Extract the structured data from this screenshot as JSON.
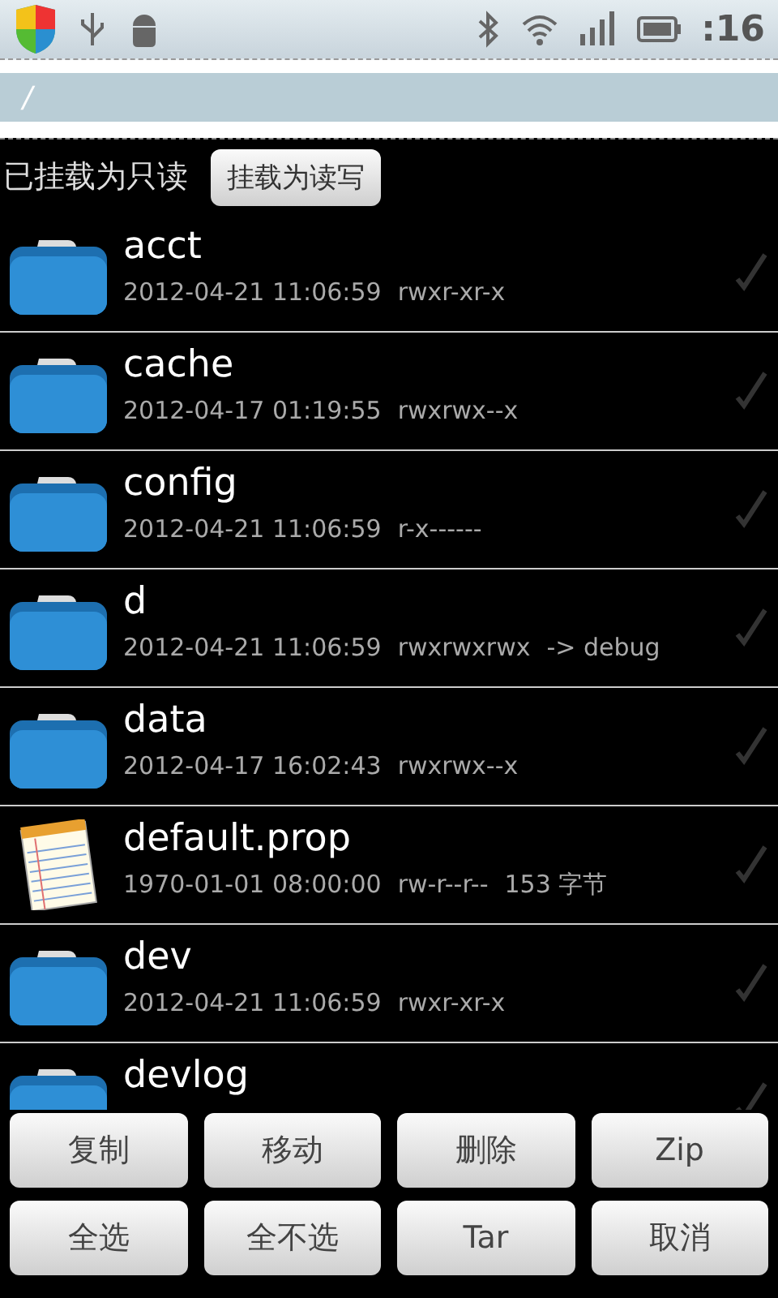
{
  "status_bar": {
    "time": ":16"
  },
  "path_bar": {
    "path": "/"
  },
  "mount": {
    "status": "已挂载为只读",
    "button": "挂载为读写"
  },
  "files": [
    {
      "kind": "folder",
      "name": "acct",
      "date": "2012-04-21 11:06:59",
      "perms": "rwxr-xr-x",
      "checked": false
    },
    {
      "kind": "folder",
      "name": "cache",
      "date": "2012-04-17 01:19:55",
      "perms": "rwxrwx--x",
      "checked": false
    },
    {
      "kind": "folder",
      "name": "config",
      "date": "2012-04-21 11:06:59",
      "perms": "r-x------",
      "checked": false
    },
    {
      "kind": "folder",
      "name": "d",
      "date": "2012-04-21 11:06:59",
      "perms": "rwxrwxrwx",
      "link": "-> debug",
      "checked": false
    },
    {
      "kind": "folder",
      "name": "data",
      "date": "2012-04-17 16:02:43",
      "perms": "rwxrwx--x",
      "checked": false
    },
    {
      "kind": "file",
      "name": "default.prop",
      "date": "1970-01-01 08:00:00",
      "perms": "rw-r--r--",
      "size": "153 字节",
      "checked": false
    },
    {
      "kind": "folder",
      "name": "dev",
      "date": "2012-04-21 11:06:59",
      "perms": "rwxr-xr-x",
      "checked": false
    },
    {
      "kind": "folder",
      "name": "devlog",
      "checked": false
    }
  ],
  "actions": [
    [
      "复制",
      "移动",
      "删除",
      "Zip"
    ],
    [
      "全选",
      "全不选",
      "Tar",
      "取消"
    ]
  ]
}
